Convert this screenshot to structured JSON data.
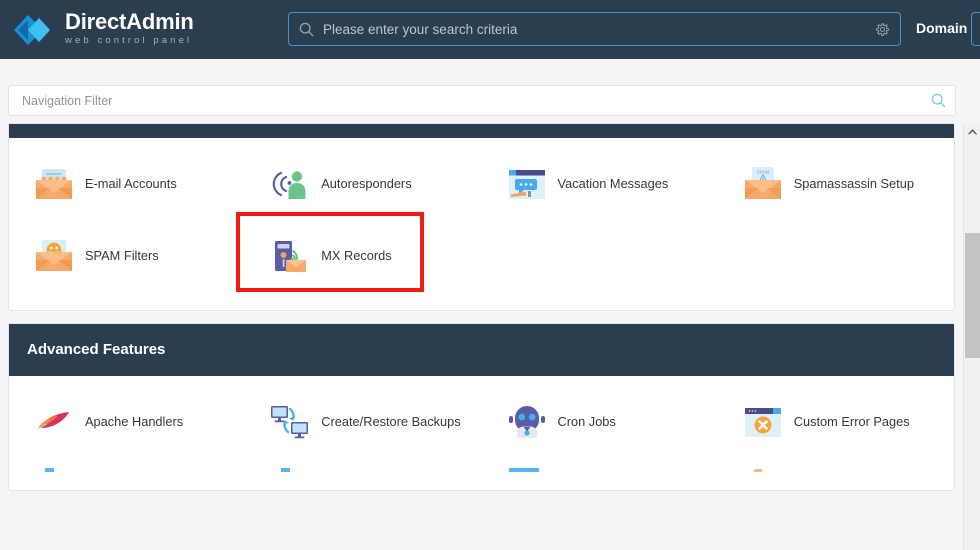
{
  "header": {
    "brand_name_bold": "Direct",
    "brand_name_light": "Admin",
    "brand_tagline": "web control panel",
    "logo_icon": "chevrons-right-icon",
    "search_placeholder": "Please enter your search criteria",
    "search_value": "",
    "search_icon": "search-icon",
    "settings_icon": "gear-icon",
    "domain_label": "Domain",
    "colors": {
      "bar_bg": "#2b3e50",
      "accent_border": "#4a93c9"
    }
  },
  "nav_filter": {
    "placeholder": "Navigation Filter",
    "value": "",
    "search_icon": "search-icon"
  },
  "cards": [
    {
      "id": "e-mail-manager",
      "title": "",
      "header_clipped": true,
      "tiles": [
        {
          "label": "E-mail Accounts",
          "icon": "envelope-password-icon",
          "highlighted": false
        },
        {
          "label": "Autoresponders",
          "icon": "person-broadcast-icon",
          "highlighted": false
        },
        {
          "label": "Vacation Messages",
          "icon": "browser-message-icon",
          "highlighted": false
        },
        {
          "label": "Spamassassin Setup",
          "icon": "envelope-spam-warning-icon",
          "highlighted": false
        },
        {
          "label": "SPAM Filters",
          "icon": "envelope-smiley-icon",
          "highlighted": false
        },
        {
          "label": "MX Records",
          "icon": "server-mail-signal-icon",
          "highlighted": true
        }
      ]
    },
    {
      "id": "advanced-features",
      "title": "Advanced Features",
      "header_clipped": false,
      "tiles": [
        {
          "label": "Apache Handlers",
          "icon": "feather-icon",
          "highlighted": false
        },
        {
          "label": "Create/Restore Backups",
          "icon": "two-monitors-sync-icon",
          "highlighted": false
        },
        {
          "label": "Cron Jobs",
          "icon": "robot-icon",
          "highlighted": false
        },
        {
          "label": "Custom Error Pages",
          "icon": "browser-error-icon",
          "highlighted": false
        }
      ],
      "partial_tiles": [
        {
          "icon": "blue-icon-partial"
        },
        {
          "icon": "blue-icon-partial"
        },
        {
          "icon": "blue-wide-icon-partial"
        },
        {
          "icon": "orange-icon-partial"
        }
      ]
    }
  ],
  "scrollbar": {
    "up_arrow_icon": "chevron-up-icon",
    "thumb_color": "#c3c3c3"
  },
  "highlight": {
    "target": "MX Records",
    "color": "#ee1b11"
  }
}
